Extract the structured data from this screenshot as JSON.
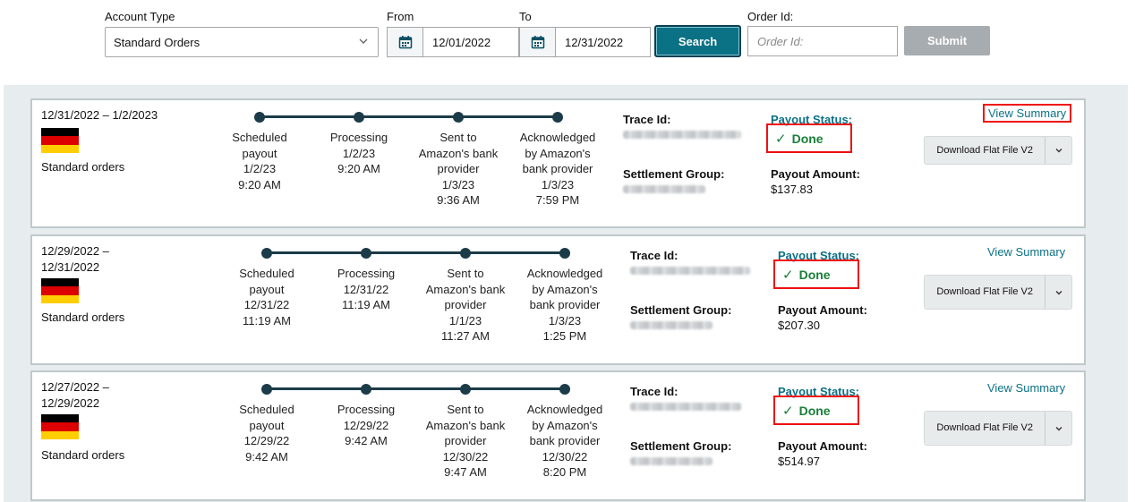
{
  "filters": {
    "account_type_label": "Account Type",
    "account_type_value": "Standard Orders",
    "from_label": "From",
    "from_value": "12/01/2022",
    "to_label": "To",
    "to_value": "12/31/2022",
    "search_label": "Search",
    "order_id_label": "Order Id:",
    "order_id_placeholder": "Order Id:",
    "submit_label": "Submit"
  },
  "labels": {
    "trace_id": "Trace Id:",
    "settlement_group": "Settlement Group:",
    "payout_status": "Payout Status:",
    "payout_amount": "Payout Amount:",
    "done": "Done",
    "view_summary": "View Summary"
  },
  "icons": {
    "calendar": "calendar-icon",
    "chevron": "chevron-down-icon",
    "check": "check-icon"
  },
  "colors": {
    "accent": "#0b7185",
    "done_green": "#1a7f37",
    "highlight_red": "#e11111",
    "track": "#1c3b48"
  },
  "cards": [
    {
      "date_range": "12/31/2022 – 1/2/2023",
      "order_type": "Standard orders",
      "steps": [
        {
          "title": "Scheduled payout",
          "lines": [
            "Scheduled",
            "payout",
            "1/2/23",
            "9:20 AM"
          ]
        },
        {
          "title": "Processing",
          "lines": [
            "Processing",
            "1/2/23",
            "9:20 AM"
          ]
        },
        {
          "title": "Sent to Amazon's bank provider",
          "lines": [
            "Sent to",
            "Amazon's bank",
            "provider",
            "1/3/23",
            "9:36 AM"
          ]
        },
        {
          "title": "Acknowledged by Amazon's bank provider",
          "lines": [
            "Acknowledged",
            "by Amazon's",
            "bank provider",
            "1/3/23",
            "7:59 PM"
          ]
        }
      ],
      "payout_amount": "$137.83",
      "download_label": "Download Flat File V2"
    },
    {
      "date_range": "12/29/2022 – 12/31/2022",
      "order_type": "Standard orders",
      "steps": [
        {
          "title": "Scheduled payout",
          "lines": [
            "Scheduled",
            "payout",
            "12/31/22",
            "11:19 AM"
          ]
        },
        {
          "title": "Processing",
          "lines": [
            "Processing",
            "12/31/22",
            "11:19 AM"
          ]
        },
        {
          "title": "Sent to Amazon's bank provider",
          "lines": [
            "Sent to",
            "Amazon's bank",
            "provider",
            "1/1/23",
            "11:27 AM"
          ]
        },
        {
          "title": "Acknowledged by Amazon's bank provider",
          "lines": [
            "Acknowledged",
            "by Amazon's",
            "bank provider",
            "1/3/23",
            "1:25 PM"
          ]
        }
      ],
      "payout_amount": "$207.30",
      "download_label": "Download Flat File V2"
    },
    {
      "date_range": "12/27/2022 – 12/29/2022",
      "order_type": "Standard orders",
      "steps": [
        {
          "title": "Scheduled payout",
          "lines": [
            "Scheduled",
            "payout",
            "12/29/22",
            "9:42 AM"
          ]
        },
        {
          "title": "Processing",
          "lines": [
            "Processing",
            "12/29/22",
            "9:42 AM"
          ]
        },
        {
          "title": "Sent to Amazon's bank provider",
          "lines": [
            "Sent to",
            "Amazon's bank",
            "provider",
            "12/30/22",
            "9:47 AM"
          ]
        },
        {
          "title": "Acknowledged by Amazon's bank provider",
          "lines": [
            "Acknowledged",
            "by Amazon's",
            "bank provider",
            "12/30/22",
            "8:20 PM"
          ]
        }
      ],
      "payout_amount": "$514.97",
      "download_label": "Download Flat File V2"
    }
  ]
}
